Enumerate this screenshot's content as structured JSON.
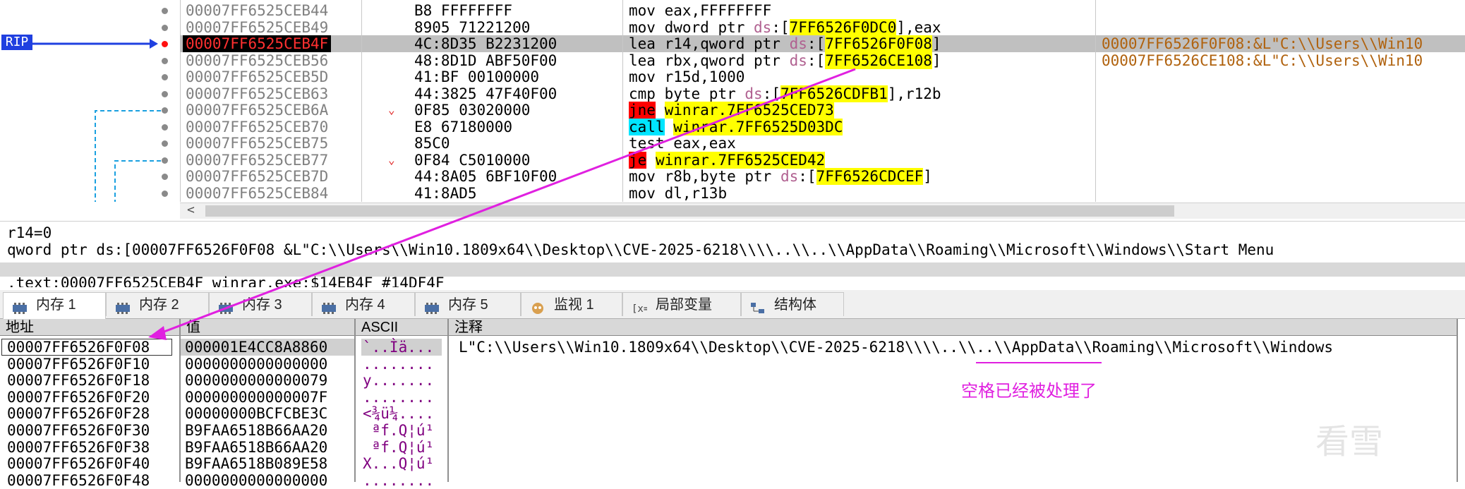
{
  "colors": {
    "rip_label_bg": "#2040e0",
    "selected_row_bg": "#c0c0c0",
    "highlight_yellow": "#ffff00",
    "annotation_magenta": "#e020e0",
    "comment_brown": "#b0620e",
    "ascii_purple": "#800080"
  },
  "rip_label": "RIP",
  "disasm_rows": [
    {
      "addr": "00007FF6525CEB44",
      "bytes": "B8 FFFFFFFF",
      "mn": "mov",
      "ops": "eax,FFFFFFFF",
      "cmt": ""
    },
    {
      "addr": "00007FF6525CEB49",
      "bytes": "8905 71221200",
      "mn": "mov",
      "ops_pre": "dword ptr ",
      "seg": "ds",
      "ops_hl": "7FF6526F0DC0",
      "ops_post": "],eax",
      "cmt": ""
    },
    {
      "addr": "00007FF6525CEB4F",
      "bytes": "4C:8D35 B2231200",
      "mn": "lea",
      "ops_pre": "r14,qword ptr ",
      "seg": "ds",
      "ops_hl": "7FF6526F0F08",
      "ops_post": "]",
      "cmt": "00007FF6526F0F08:&L\"C:\\\\Users\\\\Win10"
    },
    {
      "addr": "00007FF6525CEB56",
      "bytes": "48:8D1D ABF50F00",
      "mn": "lea",
      "ops_pre": "rbx,qword ptr ",
      "seg": "ds",
      "ops_hl": "7FF6526CE108",
      "ops_post": "]",
      "cmt": "00007FF6526CE108:&L\"C:\\\\Users\\\\Win10"
    },
    {
      "addr": "00007FF6525CEB5D",
      "bytes": "41:BF 00100000",
      "mn": "mov",
      "ops": "r15d,1000",
      "cmt": ""
    },
    {
      "addr": "00007FF6525CEB63",
      "bytes": "44:3825 47F40F00",
      "mn": "cmp",
      "ops_pre": "byte ptr ",
      "seg": "ds",
      "ops_hl": "7FF6526CDFB1",
      "ops_post": "],r12b",
      "cmt": ""
    },
    {
      "addr": "00007FF6525CEB6A",
      "bytes": "0F85 03020000",
      "mn": "jne",
      "ops_target": "winrar.7FF6525CED73",
      "cmt": ""
    },
    {
      "addr": "00007FF6525CEB70",
      "bytes": "E8 67180000",
      "mn": "call",
      "ops_target": "winrar.7FF6525D03DC",
      "cmt": ""
    },
    {
      "addr": "00007FF6525CEB75",
      "bytes": "85C0",
      "mn": "test",
      "ops": "eax,eax",
      "cmt": ""
    },
    {
      "addr": "00007FF6525CEB77",
      "bytes": "0F84 C5010000",
      "mn": "je",
      "ops_target": "winrar.7FF6525CED42",
      "cmt": ""
    },
    {
      "addr": "00007FF6525CEB7D",
      "bytes": "44:8A05 6BF10F00",
      "mn": "mov",
      "ops_pre": "r8b,byte ptr ",
      "seg": "ds",
      "ops_hl": "7FF6526CDCEF",
      "ops_post": "]",
      "cmt": ""
    },
    {
      "addr": "00007FF6525CEB84",
      "bytes": "41:8AD5",
      "mn": "mov",
      "ops": "dl,r13b",
      "cmt": ""
    }
  ],
  "info": {
    "line1": "r14=0",
    "line2": "qword ptr ds:[00007FF6526F0F08 &L\"C:\\\\Users\\\\Win10.1809x64\\\\Desktop\\\\CVE-2025-6218\\\\\\\\..\\\\..\\\\AppData\\\\Roaming\\\\Microsoft\\\\Windows\\\\Start Menu",
    "line3": ".text:00007FF6525CEB4F winrar.exe:$14EB4F #14DF4F"
  },
  "tabs": [
    {
      "label": "内存 1",
      "icon": "memory-icon"
    },
    {
      "label": "内存 2",
      "icon": "memory-icon"
    },
    {
      "label": "内存 3",
      "icon": "memory-icon"
    },
    {
      "label": "内存 4",
      "icon": "memory-icon"
    },
    {
      "label": "内存 5",
      "icon": "memory-icon"
    },
    {
      "label": "监视 1",
      "icon": "watch-icon"
    },
    {
      "label": "局部变量",
      "icon": "locals-icon"
    },
    {
      "label": "结构体",
      "icon": "struct-icon"
    }
  ],
  "dump": {
    "headers": {
      "addr": "地址",
      "val": "值",
      "ascii": "ASCII",
      "cmt": "注释"
    },
    "rows": [
      {
        "addr": "00007FF6526F0F08",
        "val": "000001E4CC8A8860",
        "ascii": "`..Ìä...",
        "cmt": "L\"C:\\\\Users\\\\Win10.1809x64\\\\Desktop\\\\CVE-2025-6218\\\\\\\\..\\\\..\\\\AppData\\\\Roaming\\\\Microsoft\\\\Windows"
      },
      {
        "addr": "00007FF6526F0F10",
        "val": "0000000000000000",
        "ascii": "........",
        "cmt": ""
      },
      {
        "addr": "00007FF6526F0F18",
        "val": "0000000000000079",
        "ascii": "y.......",
        "cmt": ""
      },
      {
        "addr": "00007FF6526F0F20",
        "val": "000000000000007F",
        "ascii": "........",
        "cmt": ""
      },
      {
        "addr": "00007FF6526F0F28",
        "val": "00000000BCFCBE3C",
        "ascii": "<¾ü¼....",
        "cmt": ""
      },
      {
        "addr": "00007FF6526F0F30",
        "val": "B9FAA6518B66AA20",
        "ascii": " ªf.Q¦ú¹",
        "cmt": ""
      },
      {
        "addr": "00007FF6526F0F38",
        "val": "B9FAA6518B66AA20",
        "ascii": " ªf.Q¦ú¹",
        "cmt": ""
      },
      {
        "addr": "00007FF6526F0F40",
        "val": "B9FAA6518B089E58",
        "ascii": "X...Q¦ú¹",
        "cmt": ""
      },
      {
        "addr": "00007FF6526F0F48",
        "val": "0000000000000000",
        "ascii": "........",
        "cmt": ""
      }
    ]
  },
  "annotation_note": "空格已经被处理了",
  "watermark": "看雪"
}
